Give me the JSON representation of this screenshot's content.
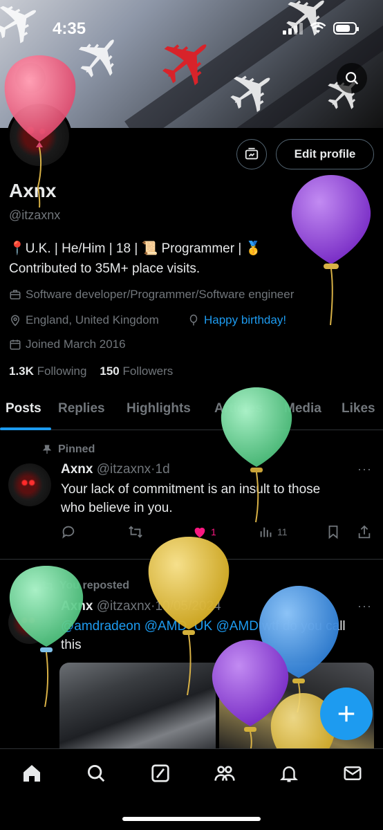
{
  "status_bar": {
    "time": "4:35"
  },
  "profile": {
    "name": "Axnx",
    "handle": "@itzaxnx",
    "edit_profile_label": "Edit profile",
    "bio_line1": "📍U.K. | He/Him | 18 |  📜 Programmer  |  🥇",
    "bio_line2": "Contributed to 35M+ place visits.",
    "category": "Software developer/Programmer/Software engineer",
    "location": "England, United Kingdom",
    "birthday_label": "Happy birthday!",
    "joined": "Joined March 2016",
    "following_count": "1.3K",
    "following_label": "Following",
    "followers_count": "150",
    "followers_label": "Followers"
  },
  "tabs": [
    "Posts",
    "Replies",
    "Highlights",
    "Articles",
    "Media",
    "Likes"
  ],
  "posts": [
    {
      "label": "Pinned",
      "author": "Axnx",
      "handle": "@itzaxnx",
      "time": "1d",
      "text_line1": "Your lack of commitment is an insult to those",
      "text_line2": "who believe in you.",
      "likes": "1",
      "views": "11"
    },
    {
      "label": "You reposted",
      "author": "Axnx",
      "handle": "@itzaxnx",
      "time": "10/05/2024",
      "mention1": "@amdradeon",
      "mention2": "@AMD_UK",
      "mention3": "@AMD",
      "text_after": " wtf do you call",
      "text_line2": "this"
    }
  ],
  "colors": {
    "accent": "#1d9bf0",
    "like": "#f91880",
    "balloon_pink": "#e85a7a",
    "balloon_purple": "#8b3fd0",
    "balloon_green": "#6fd79a",
    "balloon_yellow": "#e6c23f",
    "balloon_blue": "#3f8ee0"
  },
  "icons": [
    "back-arrow-icon",
    "search-icon",
    "dm-icon",
    "location-icon",
    "briefcase-icon",
    "balloon-icon",
    "calendar-icon",
    "pin-icon",
    "repost-icon",
    "reply-icon",
    "like-icon",
    "views-icon",
    "bookmark-icon",
    "share-icon",
    "plus-icon",
    "home-icon",
    "grok-icon",
    "communities-icon",
    "notifications-icon",
    "messages-icon"
  ]
}
